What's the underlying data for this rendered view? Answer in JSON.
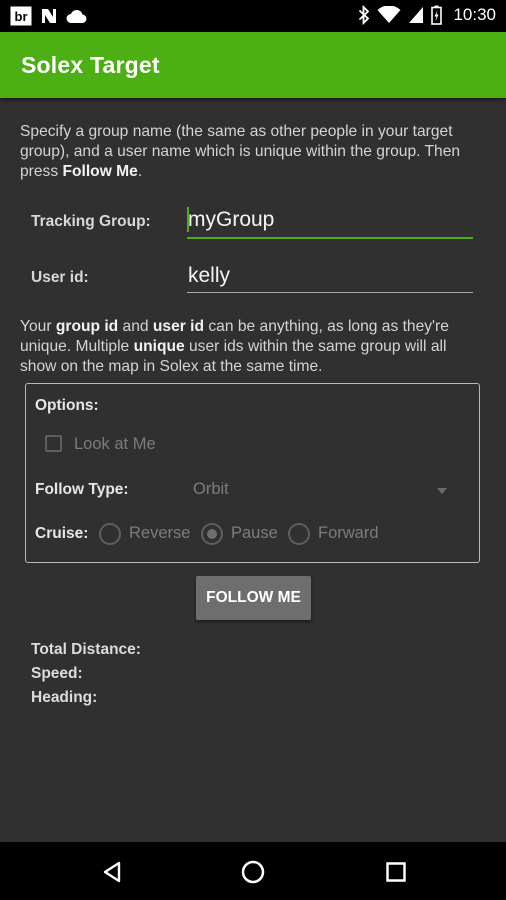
{
  "status_bar": {
    "time": "10:30",
    "left_icons": [
      "br-app-icon",
      "n-app-icon",
      "cloud-icon"
    ],
    "right_icons": [
      "bluetooth-icon",
      "wifi-icon",
      "cell-signal-icon",
      "battery-icon"
    ]
  },
  "app_bar": {
    "title": "Solex Target",
    "color": "#4caf14"
  },
  "intro": {
    "text_1": "Specify a group name (the same as other people in your target group), and a user name which is unique within the group. Then press ",
    "bold": "Follow Me",
    "text_2": "."
  },
  "form": {
    "tracking_group_label": "Tracking Group:",
    "tracking_group_value": "myGroup",
    "user_id_label": "User id:",
    "user_id_value": "kelly"
  },
  "note": {
    "t1": "Your ",
    "b1": "group id",
    "t2": " and ",
    "b2": "user id",
    "t3": " can be anything, as long as they're unique. Multiple ",
    "b3": "unique",
    "t4": " user ids within the same group will all show on the map in Solex at the same time."
  },
  "options": {
    "title": "Options:",
    "look_at_me_label": "Look at Me",
    "look_at_me_checked": false,
    "follow_type_label": "Follow Type:",
    "follow_type_value": "Orbit",
    "cruise_label": "Cruise:",
    "cruise_options": [
      "Reverse",
      "Pause",
      "Forward"
    ],
    "cruise_selected": "Pause"
  },
  "follow_button_label": "FOLLOW ME",
  "stats": {
    "total_distance_label": "Total Distance:",
    "speed_label": "Speed:",
    "heading_label": "Heading:"
  },
  "nav_bar": {
    "icons": [
      "back-icon",
      "home-icon",
      "recents-icon"
    ]
  }
}
